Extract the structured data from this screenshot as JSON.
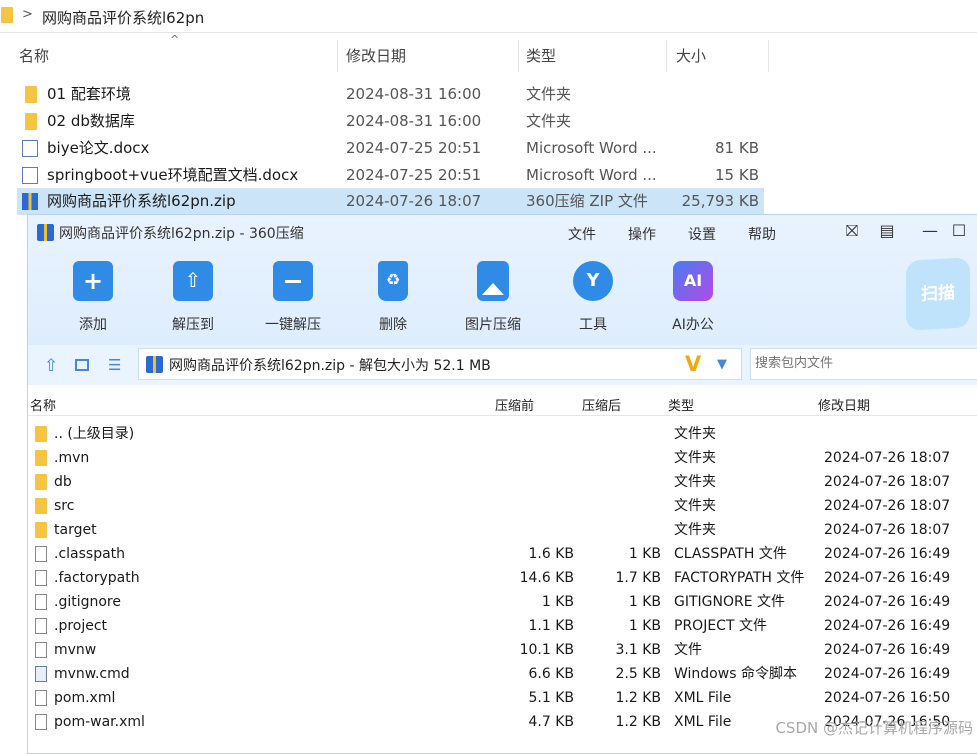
{
  "explorer": {
    "path": "网购商品评价系统l62pn",
    "columns": {
      "name": "名称",
      "date": "修改日期",
      "type": "类型",
      "size": "大小"
    },
    "rows": [
      {
        "name": "01 配套环境",
        "date": "2024-08-31 16:00",
        "type": "文件夹",
        "size": "",
        "icon": "folder-icon"
      },
      {
        "name": "02 db数据库",
        "date": "2024-08-31 16:00",
        "type": "文件夹",
        "size": "",
        "icon": "folder-icon"
      },
      {
        "name": "biye论文.docx",
        "date": "2024-07-25 20:51",
        "type": "Microsoft Word ...",
        "size": "81 KB",
        "icon": "word-doc-icon"
      },
      {
        "name": "springboot+vue环境配置文档.docx",
        "date": "2024-07-25 20:51",
        "type": "Microsoft Word ...",
        "size": "15 KB",
        "icon": "word-doc-icon"
      },
      {
        "name": "网购商品评价系统l62pn.zip",
        "date": "2024-07-26 18:07",
        "type": "360压缩 ZIP 文件",
        "size": "25,793 KB",
        "icon": "zip-icon",
        "selected": true
      }
    ]
  },
  "zip": {
    "title": "网购商品评价系统l62pn.zip - 360压缩",
    "menu": [
      "文件",
      "操作",
      "设置",
      "帮助"
    ],
    "toolbar": [
      {
        "label": "添加",
        "icon": "add-icon",
        "color": "#2f8be6"
      },
      {
        "label": "解压到",
        "icon": "extract-to-icon",
        "color": "#2f8be6"
      },
      {
        "label": "一键解压",
        "icon": "quick-extract-icon",
        "color": "#2f8be6"
      },
      {
        "label": "删除",
        "icon": "delete-icon",
        "color": "#2f8be6"
      },
      {
        "label": "图片压缩",
        "icon": "image-compress-icon",
        "color": "#2f8be6"
      },
      {
        "label": "工具",
        "icon": "tools-icon",
        "color": "#2f8be6"
      },
      {
        "label": "AI办公",
        "icon": "ai-office-icon",
        "color": "#7b55e8"
      }
    ],
    "scan_label": "扫描",
    "path_text": "网购商品评价系统l62pn.zip - 解包大小为 52.1 MB",
    "search_placeholder": "搜索包内文件",
    "columns": {
      "name": "名称",
      "compressed_before": "压缩前",
      "compressed_after": "压缩后",
      "type": "类型",
      "date": "修改日期"
    },
    "rows": [
      {
        "name": ".. (上级目录)",
        "before": "",
        "after": "",
        "type": "文件夹",
        "date": "",
        "icon": "folder-icon"
      },
      {
        "name": ".mvn",
        "before": "",
        "after": "",
        "type": "文件夹",
        "date": "2024-07-26 18:07",
        "icon": "folder-icon"
      },
      {
        "name": "db",
        "before": "",
        "after": "",
        "type": "文件夹",
        "date": "2024-07-26 18:07",
        "icon": "folder-icon"
      },
      {
        "name": "src",
        "before": "",
        "after": "",
        "type": "文件夹",
        "date": "2024-07-26 18:07",
        "icon": "folder-icon"
      },
      {
        "name": "target",
        "before": "",
        "after": "",
        "type": "文件夹",
        "date": "2024-07-26 18:07",
        "icon": "folder-icon"
      },
      {
        "name": ".classpath",
        "before": "1.6 KB",
        "after": "1 KB",
        "type": "CLASSPATH 文件",
        "date": "2024-07-26 16:49",
        "icon": "file-icon"
      },
      {
        "name": ".factorypath",
        "before": "14.6 KB",
        "after": "1.7 KB",
        "type": "FACTORYPATH 文件",
        "date": "2024-07-26 16:49",
        "icon": "file-icon"
      },
      {
        "name": ".gitignore",
        "before": "1 KB",
        "after": "1 KB",
        "type": "GITIGNORE 文件",
        "date": "2024-07-26 16:49",
        "icon": "file-icon"
      },
      {
        "name": ".project",
        "before": "1.1 KB",
        "after": "1 KB",
        "type": "PROJECT 文件",
        "date": "2024-07-26 16:49",
        "icon": "file-icon"
      },
      {
        "name": "mvnw",
        "before": "10.1 KB",
        "after": "3.1 KB",
        "type": "文件",
        "date": "2024-07-26 16:49",
        "icon": "file-icon"
      },
      {
        "name": "mvnw.cmd",
        "before": "6.6 KB",
        "after": "2.5 KB",
        "type": "Windows 命令脚本",
        "date": "2024-07-26 16:49",
        "icon": "cmd-script-icon"
      },
      {
        "name": "pom.xml",
        "before": "5.1 KB",
        "after": "1.2 KB",
        "type": "XML File",
        "date": "2024-07-26 16:50",
        "icon": "file-icon"
      },
      {
        "name": "pom-war.xml",
        "before": "4.7 KB",
        "after": "1.2 KB",
        "type": "XML File",
        "date": "2024-07-26 16:50",
        "icon": "file-icon"
      }
    ]
  },
  "watermark": "CSDN @杰记计算机程序源码"
}
